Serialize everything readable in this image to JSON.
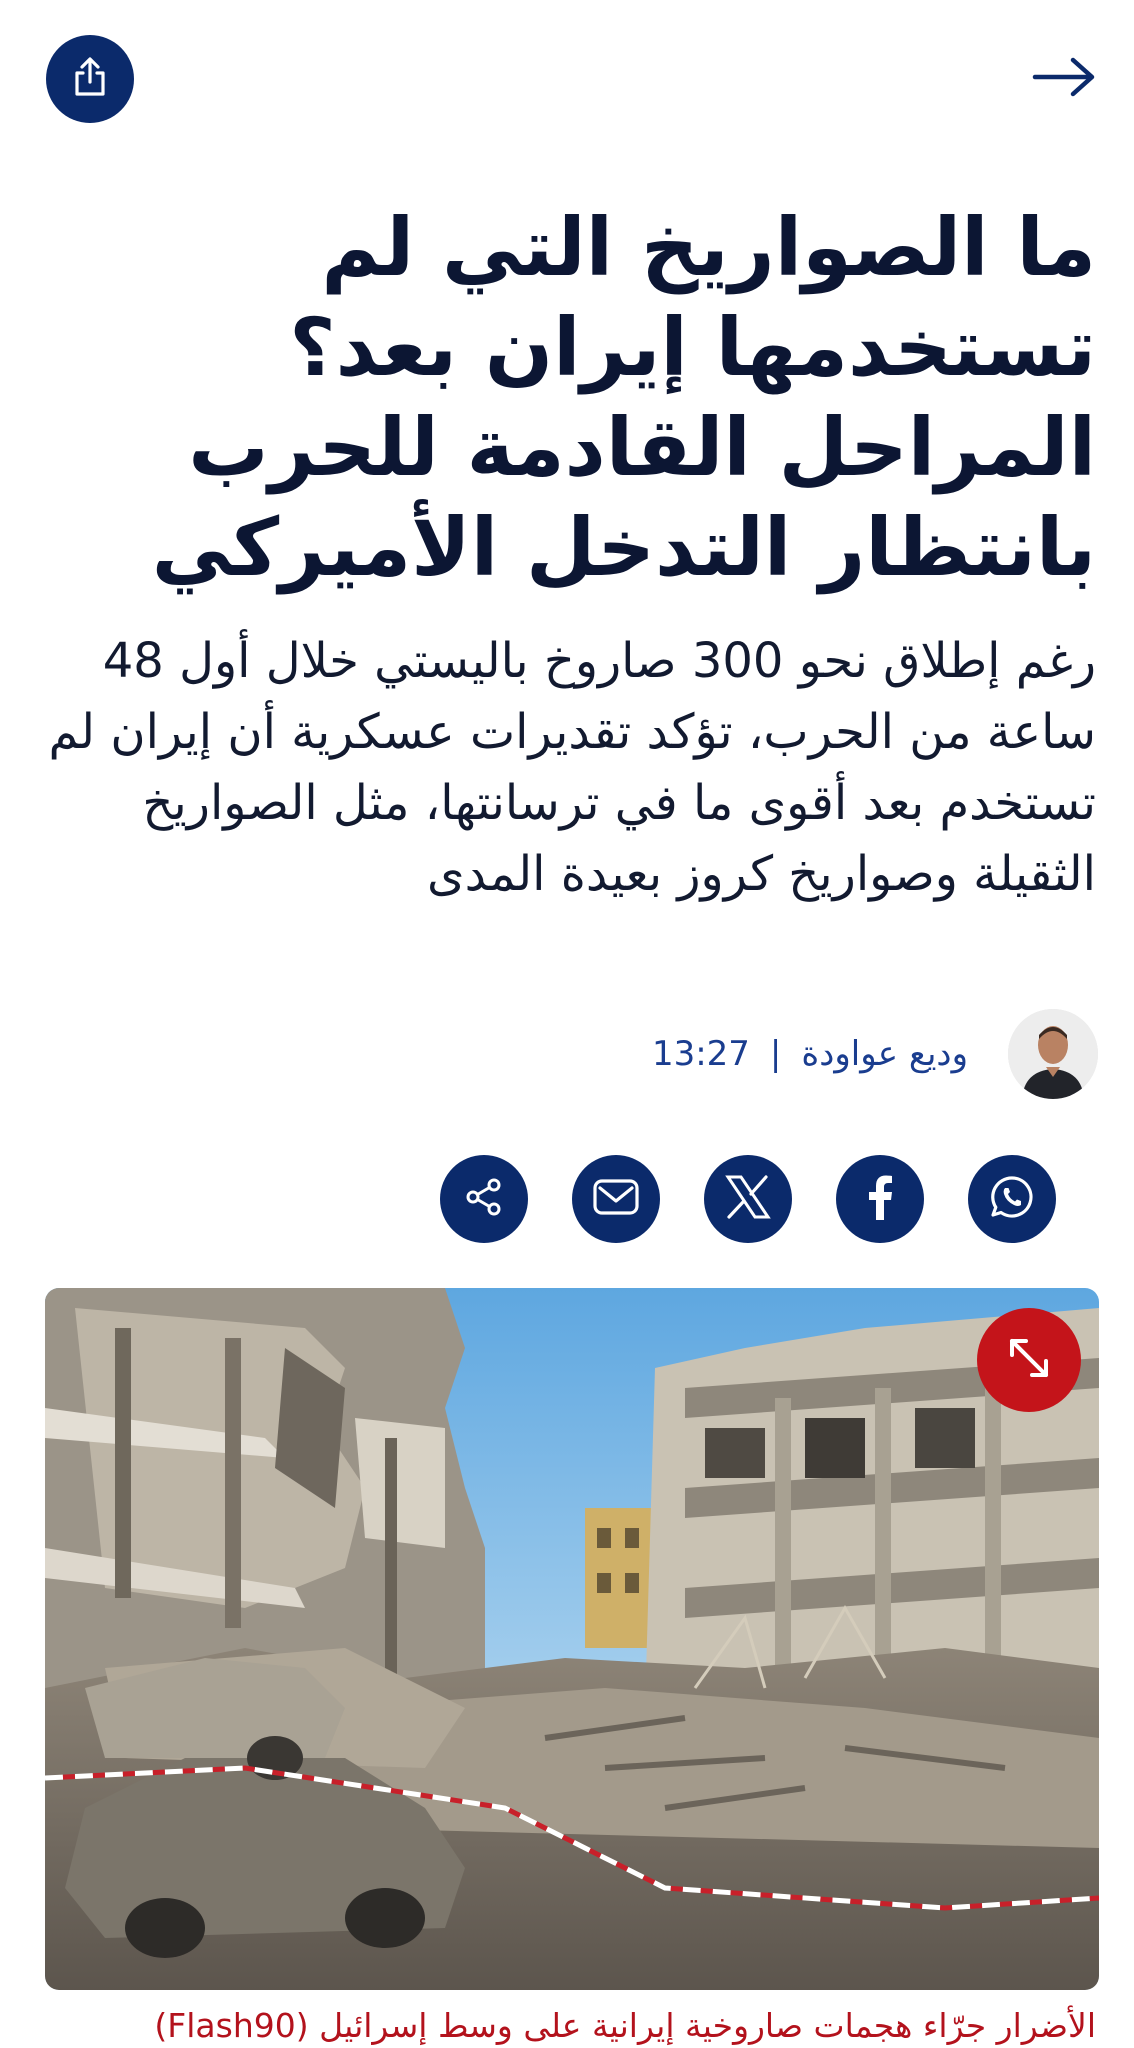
{
  "article": {
    "headline": "ما الصواريخ التي لم تستخدمها إيران بعد؟ المراحل القادمة للحرب بانتظار التدخل الأميركي",
    "subtitle": "رغم إطلاق نحو 300 صاروخ باليستي خلال أول 48 ساعة من الحرب، تؤكد تقديرات عسكرية أن إيران لم تستخدم بعد أقوى ما في ترسانتها، مثل الصواريخ الثقيلة وصواريخ كروز بعيدة المدى",
    "author": "وديع عواودة",
    "separator": "|",
    "time": "13:27",
    "image_caption": "الأضرار جرّاء هجمات صاروخية إيرانية على وسط إسرائيل (Flash90)"
  },
  "share_buttons": [
    "whatsapp-icon",
    "facebook-icon",
    "x-icon",
    "email-icon",
    "share-icon"
  ],
  "colors": {
    "brand_navy": "#0b2a6b",
    "headline": "#0c1633",
    "byline": "#1a3d8f",
    "caption_red": "#b3121c",
    "expand_red": "#c4141a"
  }
}
